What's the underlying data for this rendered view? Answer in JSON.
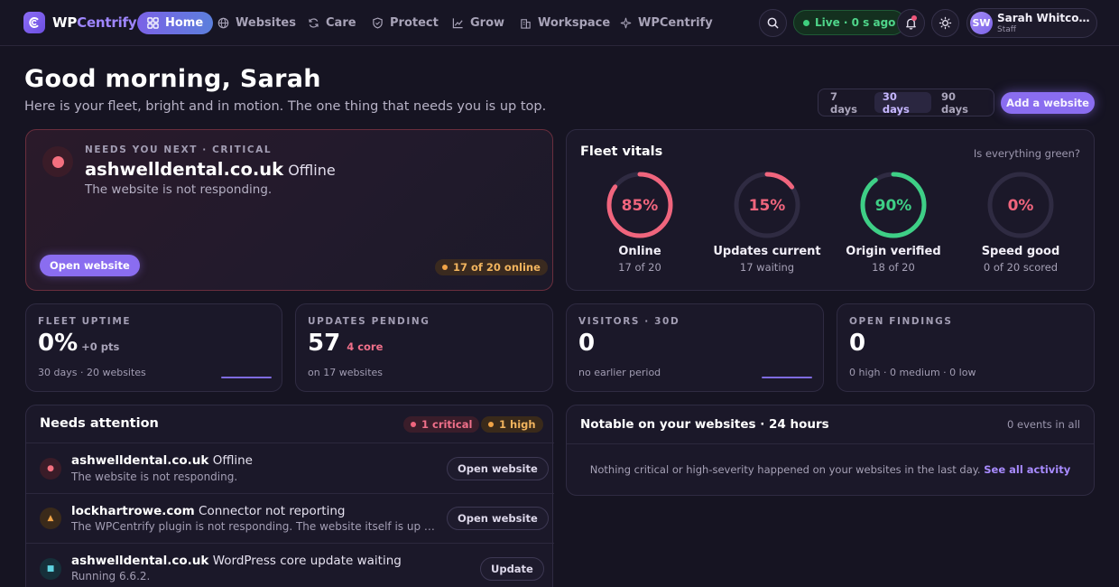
{
  "brand": {
    "wp": "WP",
    "rest": "Centrify"
  },
  "nav": [
    {
      "label": "Home",
      "icon": "grid-icon"
    },
    {
      "label": "Websites",
      "icon": "globe-icon"
    },
    {
      "label": "Care",
      "icon": "refresh-icon"
    },
    {
      "label": "Protect",
      "icon": "shield-icon"
    },
    {
      "label": "Grow",
      "icon": "chart-icon"
    },
    {
      "label": "Workspace",
      "icon": "building-icon"
    },
    {
      "label": "WPCentrify",
      "icon": "sparkle-icon"
    }
  ],
  "status": {
    "live_label": "Live · 0 s ago"
  },
  "user": {
    "initials": "SW",
    "name": "Sarah Whitcombe",
    "role": "Staff"
  },
  "hero": {
    "greeting": "Good morning, Sarah",
    "subtitle": "Here is your fleet, bright and in motion. The one thing that needs you is up top."
  },
  "range": {
    "options": [
      "7 days",
      "30 days",
      "90 days"
    ],
    "selected": "30 days"
  },
  "add_website_label": "Add a website",
  "next": {
    "eyebrow": "NEEDS YOU NEXT · CRITICAL",
    "site": "ashwelldental.co.uk",
    "status": "Offline",
    "description": "The website is not responding.",
    "button": "Open website",
    "online_pill": "17 of 20 online"
  },
  "vitals": {
    "title": "Fleet vitals",
    "question": "Is everything green?",
    "items": [
      {
        "percent": "85%",
        "fraction": 0.85,
        "label": "Online",
        "sub": "17 of 20",
        "color": "#f0657d"
      },
      {
        "percent": "15%",
        "fraction": 0.15,
        "label": "Updates current",
        "sub": "17 waiting",
        "color": "#f0657d"
      },
      {
        "percent": "90%",
        "fraction": 0.9,
        "label": "Origin verified",
        "sub": "18 of 20",
        "color": "#3ecf86"
      },
      {
        "percent": "0%",
        "fraction": 0.0,
        "label": "Speed good",
        "sub": "0 of 20 scored",
        "color": "#f0657d"
      }
    ]
  },
  "stats": [
    {
      "label": "FLEET UPTIME",
      "value": "0%",
      "extra": "+0 pts",
      "extra_color": "#a9a4b9",
      "note": "30 days · 20 websites"
    },
    {
      "label": "UPDATES PENDING",
      "value": "57",
      "extra": "4 core",
      "extra_color": "#f0708a",
      "note": "on 17 websites"
    },
    {
      "label": "VISITORS · 30D",
      "value": "0",
      "extra": "",
      "extra_color": "#a9a4b9",
      "note": "no earlier period"
    },
    {
      "label": "OPEN FINDINGS",
      "value": "0",
      "extra": "",
      "extra_color": "#a9a4b9",
      "note": "0 high · 0 medium · 0 low"
    }
  ],
  "attention": {
    "title": "Needs attention",
    "critical_pill": "1 critical",
    "high_pill": "1 high",
    "rows": [
      {
        "site": "ashwelldental.co.uk",
        "issue": "Offline",
        "sub": "The website is not responding.",
        "action": "Open website",
        "icon": "critical-dot-icon",
        "glyph": "●",
        "color": "#f3707f",
        "bg": "#3a1c28"
      },
      {
        "site": "lockhartrowe.com",
        "issue": "Connector not reporting",
        "sub": "The WPCentrify plugin is not responding. The website itself is up — reinstall the connector.",
        "action": "Open website",
        "icon": "warning-icon",
        "glyph": "▲",
        "color": "#f0a347",
        "bg": "#3a2a1a"
      },
      {
        "site": "ashwelldental.co.uk",
        "issue": "WordPress core update waiting",
        "sub": "Running 6.6.2.",
        "action": "Update",
        "icon": "info-square-icon",
        "glyph": "■",
        "color": "#5ed3e0",
        "bg": "#16303a"
      }
    ]
  },
  "notable": {
    "title": "Notable on your websites · 24 hours",
    "count": "0 events in all",
    "empty": "Nothing critical or high-severity happened on your websites in the last day.",
    "link": "See all activity"
  }
}
